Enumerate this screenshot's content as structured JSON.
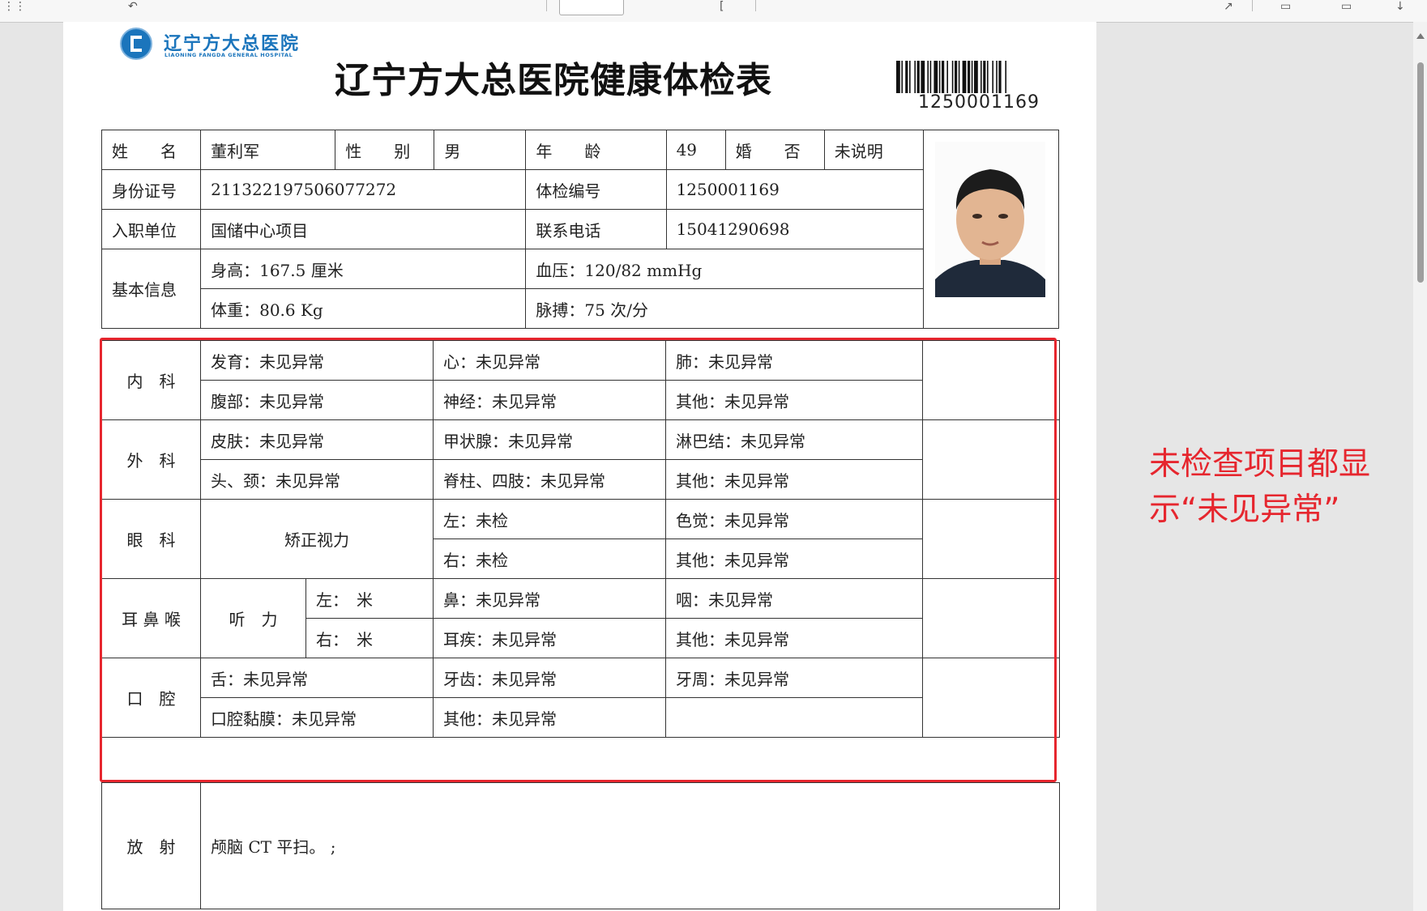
{
  "colors": {
    "accent_red": "#e6262e",
    "logo_blue": "#1b75bc"
  },
  "logo": {
    "name_cn": "辽宁方大总医院",
    "name_en": "LIAONING FANGDA GENERAL HOSPITAL"
  },
  "title": "辽宁方大总医院健康体检表",
  "barcode_number": "1250001169",
  "basic": {
    "name_label": "姓　　名",
    "name": "董利军",
    "gender_label": "性　　别",
    "gender": "男",
    "age_label": "年　　龄",
    "age": "49",
    "marital_label": "婚　　否",
    "marital": "未说明",
    "id_label": "身份证号",
    "id_number": "211322197506077272",
    "exam_no_label": "体检编号",
    "exam_no": "1250001169",
    "employer_label": "入职单位",
    "employer": "国储中心项目",
    "phone_label": "联系电话",
    "phone": "15041290698",
    "info_label": "基本信息",
    "height": "身高：167.5 厘米",
    "bp": "血压：120/82 mmHg",
    "weight": "体重：80.6 Kg",
    "pulse": "脉搏：75 次/分"
  },
  "internal": {
    "label": "内　科",
    "row1": [
      "发育：未见异常",
      "心：未见异常",
      "肺：未见异常"
    ],
    "row2": [
      "腹部：未见异常",
      "神经：未见异常",
      "其他：未见异常"
    ]
  },
  "surgery": {
    "label": "外　科",
    "row1": [
      "皮肤：未见异常",
      "甲状腺：未见异常",
      "淋巴结：未见异常"
    ],
    "row2": [
      "头、颈：未见异常",
      "脊柱、四肢：未见异常",
      "其他：未见异常"
    ]
  },
  "eye": {
    "label": "眼　科",
    "vision_label": "矫正视力",
    "left": "左：未检",
    "right": "右：未检",
    "color": "色觉：未见异常",
    "other": "其他：未见异常"
  },
  "ent": {
    "label": "耳 鼻 喉",
    "hearing_label": "听　力",
    "left_ear": "左：　米",
    "right_ear": "右：　米",
    "nose": "鼻：未见异常",
    "throat": "咽：未见异常",
    "ear": "耳疾：未见异常",
    "other": "其他：未见异常"
  },
  "oral": {
    "label": "口　腔",
    "row1": [
      "舌：未见异常",
      "牙齿：未见异常",
      "牙周：未见异常"
    ],
    "row2": [
      "口腔黏膜：未见异常",
      "其他：未见异常"
    ]
  },
  "radiology": {
    "label": "放　射",
    "value": "颅脑 CT 平扫。 ;"
  },
  "annotation": {
    "line1": "未检查项目都显",
    "line2": "示“未见异常”"
  }
}
